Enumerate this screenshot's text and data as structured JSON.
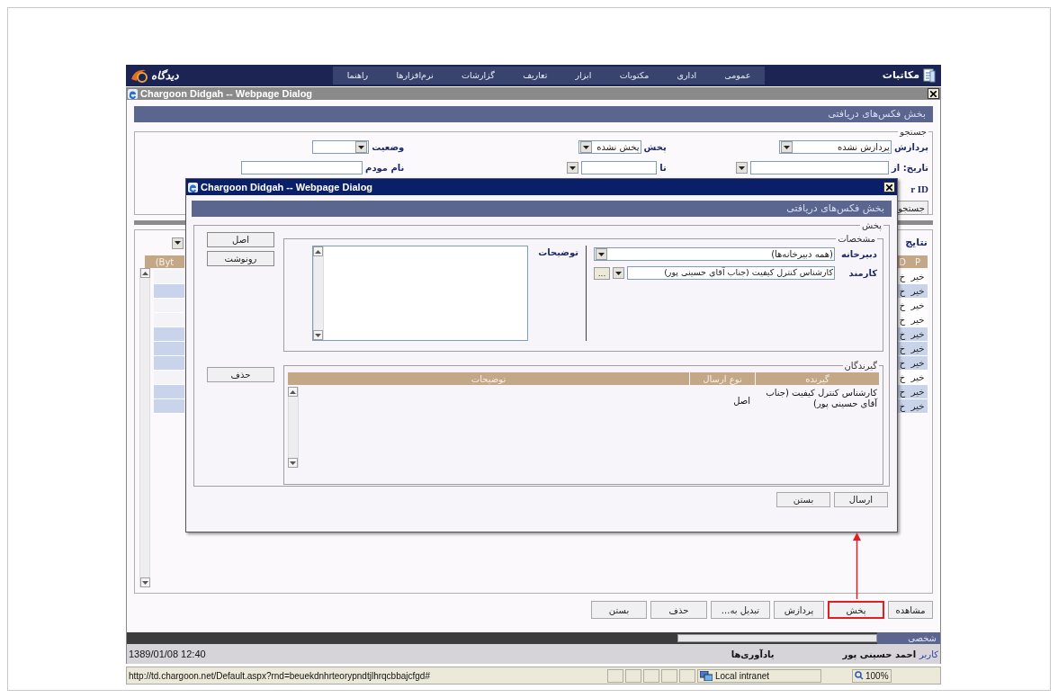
{
  "header": {
    "logo": "دیدگاه",
    "brand": "مکاتبات",
    "menu": [
      "عمومی",
      "اداری",
      "مکتوبات",
      "ابزار",
      "تعاریف",
      "گزارشات",
      "نرم‌افزارها",
      "راهنما"
    ]
  },
  "dialog": {
    "title": "Chargoon Didgah -- Webpage Dialog",
    "heading": "بخش فکس‌های دریافتی",
    "search": {
      "legend": "جستجو",
      "rows": [
        [
          {
            "label": "پردازش",
            "value": "پردازش نشده",
            "kind": "select"
          },
          {
            "label": "پخش",
            "value": "پخش نشده",
            "kind": "select"
          },
          {
            "label": "وضعیت",
            "kind": "select"
          }
        ],
        [
          {
            "label": "تاریخ: از",
            "kind": "combo"
          },
          {
            "label": "تا",
            "kind": "combo"
          },
          {
            "label": "نام مودم",
            "kind": "text"
          }
        ]
      ],
      "partial_label": "r ID",
      "button": "جستجو"
    },
    "results": {
      "label": "نتایج",
      "left_column": "(Byt",
      "columns": [
        "P",
        "D"
      ],
      "rows": [
        {
          "p": "خیر",
          "d": "خ",
          "highlighted": false
        },
        {
          "p": "خیر",
          "d": "خ",
          "highlighted": true
        },
        {
          "p": "خیر",
          "d": "خ",
          "highlighted": false
        },
        {
          "p": "خیر",
          "d": "خ",
          "highlighted": false
        },
        {
          "p": "خیر",
          "d": "خ",
          "highlighted": true
        },
        {
          "p": "خیر",
          "d": "خ",
          "highlighted": true
        },
        {
          "p": "خیر",
          "d": "خ",
          "highlighted": true
        },
        {
          "p": "خیر",
          "d": "خ",
          "highlighted": false
        },
        {
          "p": "خیر",
          "d": "خ",
          "highlighted": true
        },
        {
          "p": "خیر",
          "d": "خ",
          "highlighted": true
        }
      ]
    },
    "buttons": [
      {
        "label": "مشاهده",
        "highlighted": false
      },
      {
        "label": "پخش",
        "highlighted": true
      },
      {
        "label": "پردازش",
        "highlighted": false
      },
      {
        "label": "تبدیل به...",
        "highlighted": false
      },
      {
        "label": "حذف",
        "highlighted": false
      },
      {
        "label": "بستن",
        "highlighted": false
      }
    ]
  },
  "inner_dialog": {
    "title": "Chargoon Didgah -- Webpage Dialog",
    "heading": "بخش فکس‌های دریافتی",
    "legend": "پخش",
    "details": {
      "legend": "مشخصات",
      "secretariat_label": "دبیرخانه",
      "secretariat_value": "(همه دبیرخانه‌ها)",
      "employee_label": "کارمند",
      "employee_value": "کارشناس کنترل کیفیت (جناب آقای حسینی پور)",
      "more": "...",
      "notes_label": "توضیحات"
    },
    "side_buttons": [
      "اصل",
      "رونوشت"
    ],
    "delete_button": "حذف",
    "recipients": {
      "legend": "گیرندگان",
      "columns": [
        "گیرنده",
        "نوع ارسال",
        "توضیحات"
      ],
      "rows": [
        {
          "recipient": "کارشناس کنترل کیفیت (جناب آقای حسینی پور)",
          "send_type": "اصل"
        }
      ]
    },
    "buttons": [
      "ارسال",
      "بستن"
    ]
  },
  "footer": {
    "tab": "شخصی",
    "user_label": "کاربر",
    "user_name": "احمد حسینی پور",
    "reminders": "یادآوری‌ها",
    "datetime": "1389/01/08 12:40"
  },
  "browser_status": {
    "url": "http://td.chargoon.net/Default.aspx?rnd=beuekdnhrteorypndtjlhrqcbbajcfgd#",
    "zone": "Local intranet",
    "zoom": "100%"
  }
}
